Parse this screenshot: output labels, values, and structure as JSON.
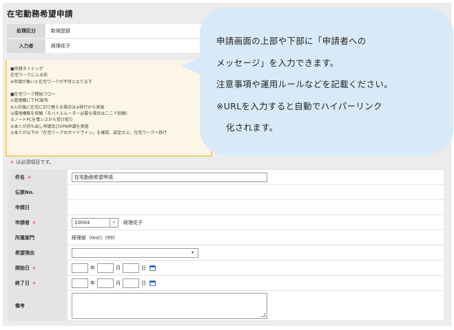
{
  "page": {
    "title": "在宅勤務希望申請"
  },
  "meta": {
    "process_label": "処理区分",
    "process_value": "新規登録",
    "entry_label": "入力者",
    "entry_value": "経理花子"
  },
  "notice": {
    "lines": [
      "■申請タイミング",
      "在宅ワークに入る前",
      "※申請が無いと在宅ワークが不可となります",
      "",
      "■在宅ワーク開始フロー",
      "①管理職にてPC配布",
      "※入社後に在宅に切り替える場合は②移行から実施",
      "②環境構築を依頼（モバイルルーター必要な場合はここで依頼）",
      "③ノートPCを情シスから受け取り",
      "④本人が持ち出し申請及びVPN申請を実施",
      "⑤本人が以下の「在宅ワークのガイドライン」を確認、設定の上、在宅ワークへ移行"
    ]
  },
  "callout": {
    "line1": "申請画面の上部や下部に「申請者への",
    "line2": "メッセージ」を入力できます。",
    "line3": "注意事項や運用ルールなどを記載ください。",
    "line4": "※URLを入力すると自動でハイパーリンク",
    "line5": "化されます。"
  },
  "form": {
    "required_note_mark": "＊",
    "required_note_text": "は必須項目です。",
    "required_mark": "＊",
    "subject_label": "件名",
    "subject_value": "在宅勤務希望申請",
    "slip_label": "伝票No.",
    "date_label": "申請日",
    "applicant_label": "申請者",
    "applicant_code": "10004",
    "applicant_name": "経理花子",
    "dept_label": "所属部門",
    "dept_value": "経理部（test）(99)",
    "reason_label": "希望理由",
    "start_label": "開始日",
    "end_label": "終了日",
    "remarks_label": "備考",
    "unit_year": "年",
    "unit_month": "月",
    "unit_day": "日"
  },
  "colors": {
    "callout_bg": "#d8eaf7",
    "notice_border": "#f2d168",
    "required": "#e0403d",
    "calendar_icon": "#2f6cd3"
  },
  "icons": {
    "search": "search-icon",
    "calendar": "calendar-icon",
    "dropdown": "chevron-down-icon"
  }
}
